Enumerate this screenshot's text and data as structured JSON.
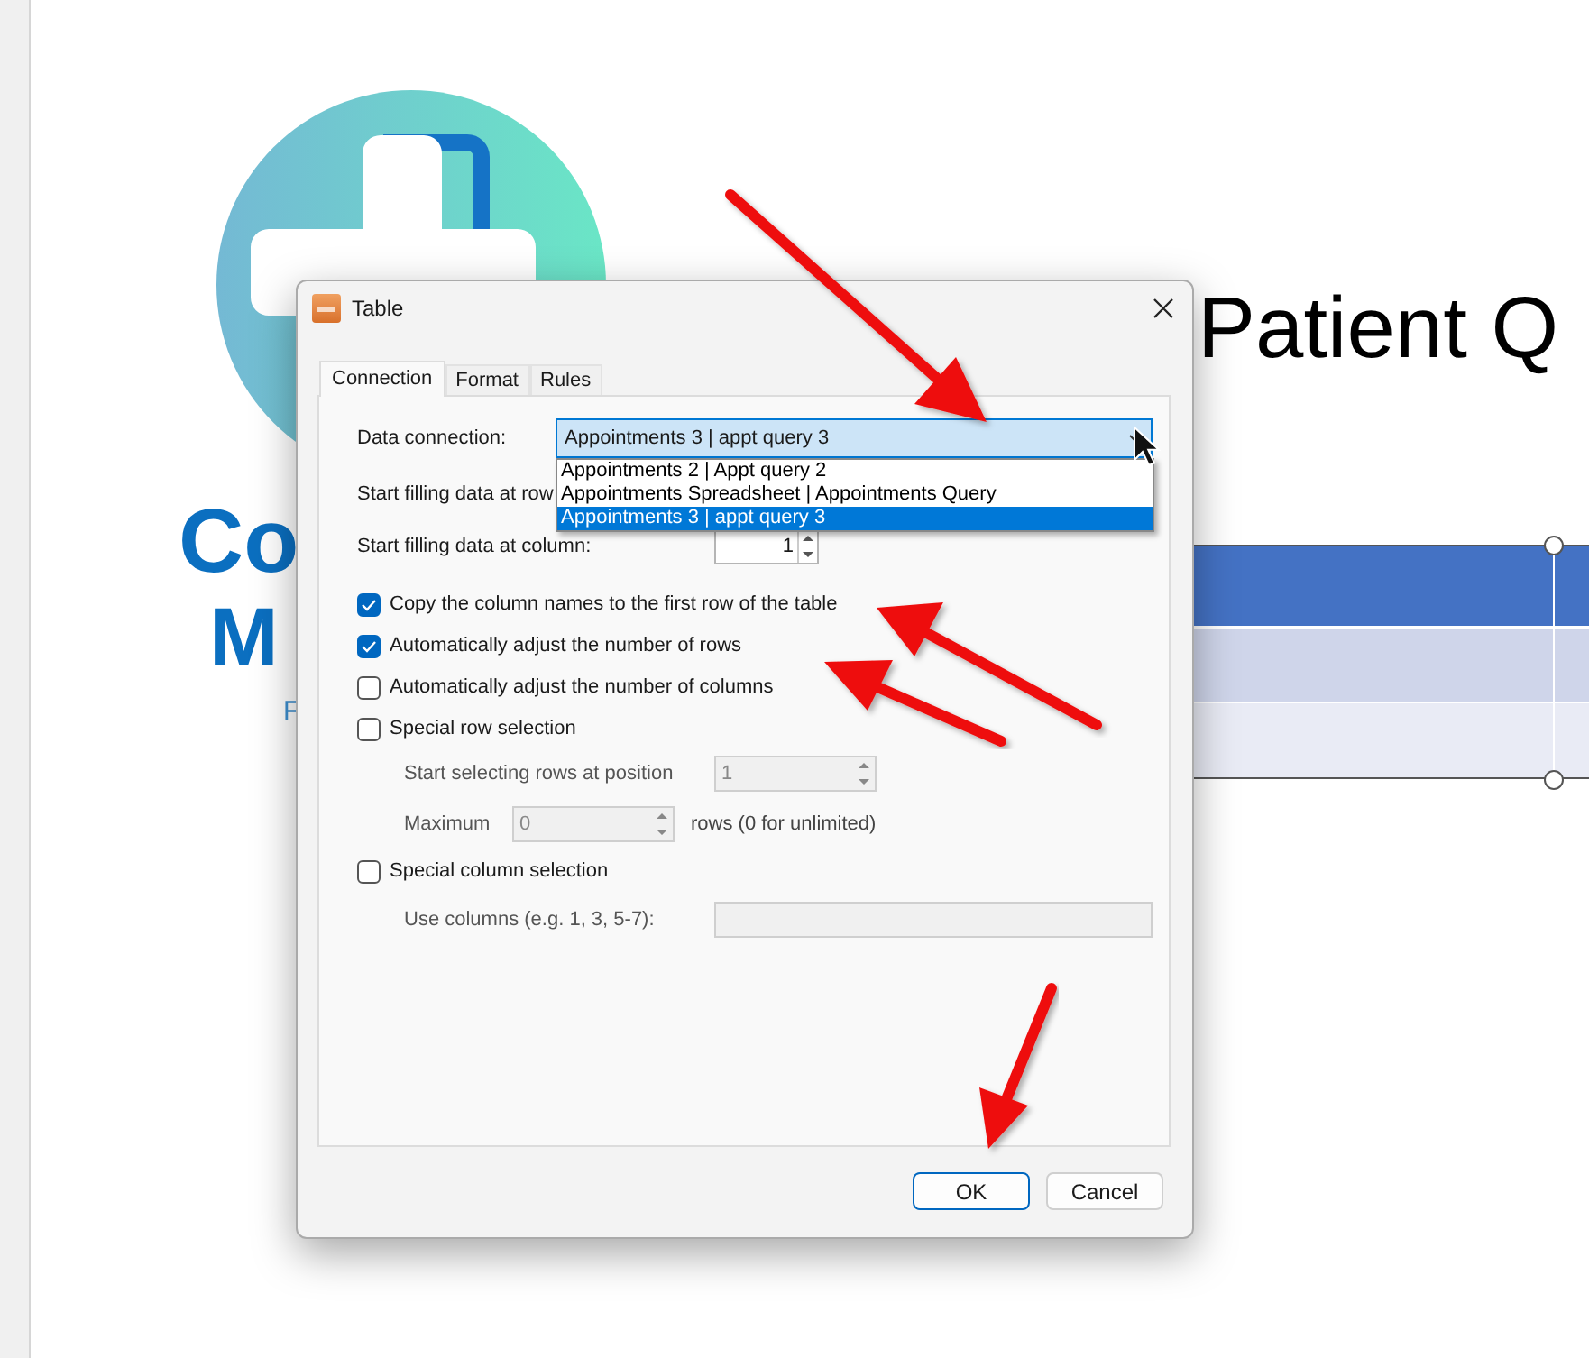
{
  "slide": {
    "logo_text": [
      "Co",
      "M",
      "F"
    ],
    "title": "Patient Q"
  },
  "dialog": {
    "title": "Table",
    "tabs": [
      {
        "label": "Connection",
        "selected": true
      },
      {
        "label": "Format",
        "selected": false
      },
      {
        "label": "Rules",
        "selected": false
      }
    ],
    "data_connection": {
      "label": "Data connection:",
      "value": "Appointments 3 | appt query 3",
      "expanded": true,
      "options": [
        {
          "label": "Appointments 2 | Appt query 2",
          "selected": false
        },
        {
          "label": "Appointments Spreadsheet | Appointments Query",
          "selected": false
        },
        {
          "label": "Appointments 3 | appt query 3",
          "selected": true
        }
      ]
    },
    "start_row": {
      "label": "Start filling data at row"
    },
    "start_column": {
      "label": "Start filling data at column:",
      "value": "1"
    },
    "checkboxes": [
      {
        "label": "Copy the column names to the first row of the table",
        "checked": true
      },
      {
        "label": "Automatically adjust the number of rows",
        "checked": true
      },
      {
        "label": "Automatically adjust the number of columns",
        "checked": false
      },
      {
        "label": "Special row selection",
        "checked": false
      }
    ],
    "row_position": {
      "label": "Start selecting rows at position",
      "value": "1",
      "disabled": true
    },
    "maximum": {
      "label": "Maximum",
      "value": "0",
      "suffix": "rows (0 for unlimited)",
      "disabled": true
    },
    "column_selection": {
      "label": "Special column selection",
      "checked": false
    },
    "use_columns": {
      "label": "Use columns (e.g. 1, 3, 5-7):",
      "disabled": true
    },
    "buttons": [
      {
        "label": "OK",
        "default": true
      },
      {
        "label": "Cancel",
        "default": false
      }
    ]
  }
}
